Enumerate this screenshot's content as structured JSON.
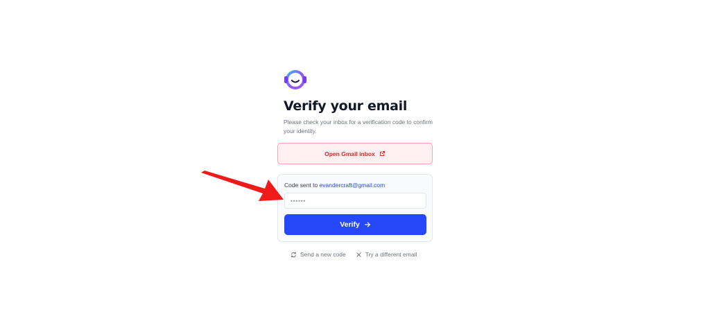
{
  "page": {
    "title": "Verify your email",
    "subtitle": "Please check your inbox for a verification code to confirm your identity."
  },
  "gmail_button": {
    "label": "Open Gmail inbox",
    "icon": "external-link-icon"
  },
  "code_card": {
    "sent_prefix": "Code sent to",
    "email": "evandercraft@gmail.com",
    "input_placeholder": "••••••",
    "input_value": "",
    "verify_label": "Verify",
    "verify_icon": "arrow-right-icon"
  },
  "footer": {
    "resend_label": "Send a new code",
    "resend_icon": "refresh-icon",
    "different_email_label": "Try a different email",
    "different_email_icon": "close-icon"
  },
  "colors": {
    "accent": "#2647f7",
    "gmail_text": "#dc2626",
    "gmail_bg": "#fff1f1",
    "email_link": "#2549f2",
    "annotation_arrow": "#ef1b1b"
  }
}
